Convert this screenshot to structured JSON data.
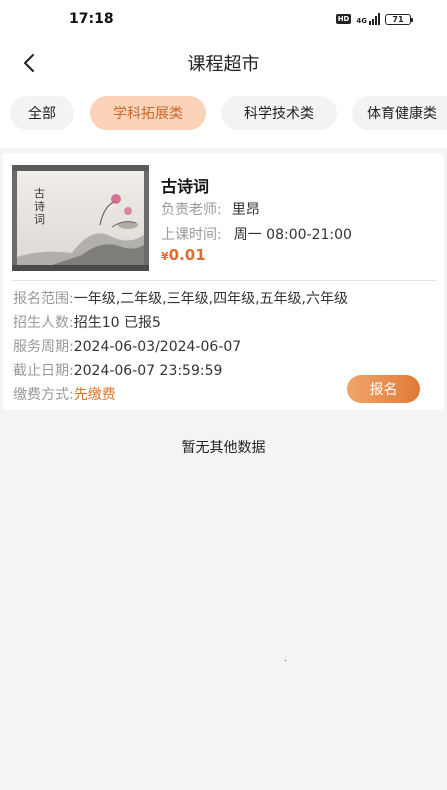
{
  "status_bar": {
    "time": "17:18",
    "hd": "HD",
    "network": "4G",
    "battery": "71"
  },
  "header": {
    "title": "课程超市",
    "back_icon": "chevron-left-icon"
  },
  "tabs": [
    {
      "label": "全部",
      "active": false
    },
    {
      "label": "学科拓展类",
      "active": true
    },
    {
      "label": "科学技术类",
      "active": false
    },
    {
      "label": "体育健康类",
      "active": false
    }
  ],
  "course": {
    "name": "古诗词",
    "thumbnail_text": "古诗词",
    "teacher_label": "负责老师:",
    "teacher": "里昂",
    "time_label": "上课时间:",
    "time": "周一 08:00-21:00",
    "currency": "¥",
    "price": "0.01",
    "scope_label": "报名范围:",
    "scope": "一年级,二年级,三年级,四年级,五年级,六年级",
    "enroll_label": "招生人数:",
    "enroll": "招生10 已报5",
    "period_label": "服务周期:",
    "period": "2024-06-03/2024-06-07",
    "deadline_label": "截止日期:",
    "deadline": "2024-06-07 23:59:59",
    "payment_label": "缴费方式:",
    "payment": "先缴费",
    "signup_button": "报名"
  },
  "empty_message": "暂无其他数据",
  "colors": {
    "accent": "#e07a36",
    "tab_active_bg": "#fad3b8",
    "price": "#e06c32"
  }
}
